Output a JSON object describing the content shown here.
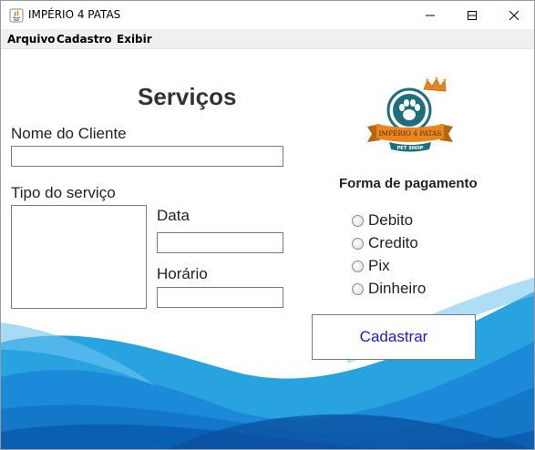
{
  "window": {
    "title": "IMPÉRIO 4 PATAS"
  },
  "menu": {
    "items": [
      "Arquivo",
      "Cadastro",
      "Exibir"
    ]
  },
  "form": {
    "heading": "Serviços",
    "client_name_label": "Nome do Cliente",
    "client_name_value": "",
    "service_type_label": "Tipo do serviço",
    "service_type_value": "",
    "date_label": "Data",
    "date_value": "",
    "time_label": "Horário",
    "time_value": ""
  },
  "payment": {
    "title": "Forma de pagamento",
    "options": [
      "Debito",
      "Credito",
      "Pix",
      "Dinheiro"
    ],
    "selected": null
  },
  "actions": {
    "submit_label": "Cadastrar"
  },
  "logo": {
    "banner_text": "IMPÉRIO 4 PATAS",
    "sub_text": "PET SHOP"
  },
  "colors": {
    "wave_light": "#29a3e0",
    "wave_mid": "#1478c8",
    "wave_dark": "#0b4fa0",
    "logo_teal": "#1e6f7d",
    "logo_orange": "#e7861e",
    "button_text": "#1a1ad6"
  }
}
